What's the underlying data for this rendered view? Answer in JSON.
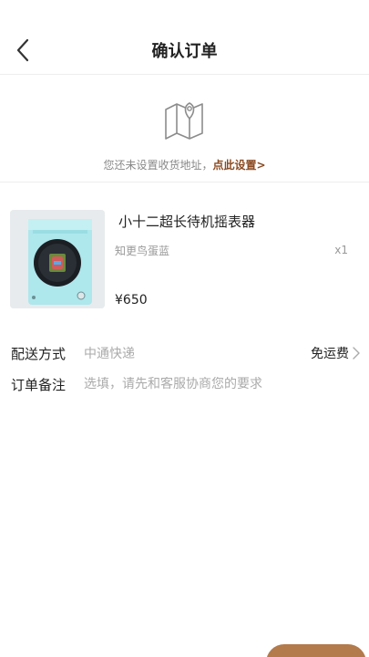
{
  "header": {
    "title": "确认订单",
    "back_icon": "chevron-left-icon"
  },
  "address": {
    "icon": "map-pin-icon",
    "prompt": "您还未设置收货地址，",
    "link": "点此设置>",
    "link_color": "#8a4a22"
  },
  "product": {
    "name": "小十二超长待机摇表器",
    "variant": "知更鸟蛋蓝",
    "quantity": "x1",
    "price": "¥650"
  },
  "delivery": {
    "label": "配送方式",
    "method": "中通快递",
    "fee": "免运费"
  },
  "remark": {
    "label": "订单备注",
    "placeholder": "选填，请先和客服协商您的要求"
  },
  "colors": {
    "accent": "#b37a4c",
    "text": "#222222",
    "muted": "#999999"
  }
}
